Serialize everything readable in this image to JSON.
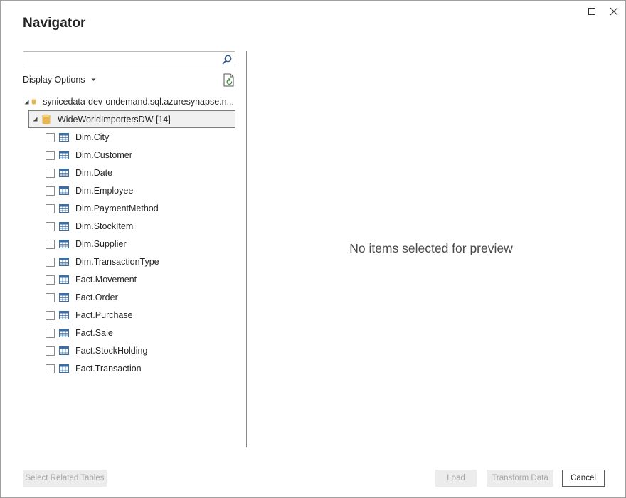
{
  "window": {
    "title": "Navigator"
  },
  "search": {
    "value": "",
    "placeholder": ""
  },
  "display_options": {
    "label": "Display Options"
  },
  "tree": {
    "server": {
      "label": "synicedata-dev-ondemand.sql.azuresynapse.n..."
    },
    "database": {
      "label": "WideWorldImportersDW [14]"
    },
    "tables": [
      {
        "label": "Dim.City",
        "checked": false
      },
      {
        "label": "Dim.Customer",
        "checked": false
      },
      {
        "label": "Dim.Date",
        "checked": false
      },
      {
        "label": "Dim.Employee",
        "checked": false
      },
      {
        "label": "Dim.PaymentMethod",
        "checked": false
      },
      {
        "label": "Dim.StockItem",
        "checked": false
      },
      {
        "label": "Dim.Supplier",
        "checked": false
      },
      {
        "label": "Dim.TransactionType",
        "checked": false
      },
      {
        "label": "Fact.Movement",
        "checked": false
      },
      {
        "label": "Fact.Order",
        "checked": false
      },
      {
        "label": "Fact.Purchase",
        "checked": false
      },
      {
        "label": "Fact.Sale",
        "checked": false
      },
      {
        "label": "Fact.StockHolding",
        "checked": false
      },
      {
        "label": "Fact.Transaction",
        "checked": false
      }
    ]
  },
  "preview": {
    "message": "No items selected for preview"
  },
  "footer": {
    "select_related_label": "Select Related Tables",
    "load_label": "Load",
    "transform_label": "Transform Data",
    "cancel_label": "Cancel"
  },
  "colors": {
    "db_icon": "#e8b650",
    "table_icon": "#3a6ea5",
    "search_icon": "#2b5797"
  },
  "icons": {
    "maximize": "maximize-icon",
    "close": "close-icon",
    "search": "search-icon",
    "dropdown": "chevron-down-icon",
    "refresh": "refresh-icon",
    "expander": "expand-triangle-icon",
    "database": "database-icon",
    "table": "table-icon"
  }
}
